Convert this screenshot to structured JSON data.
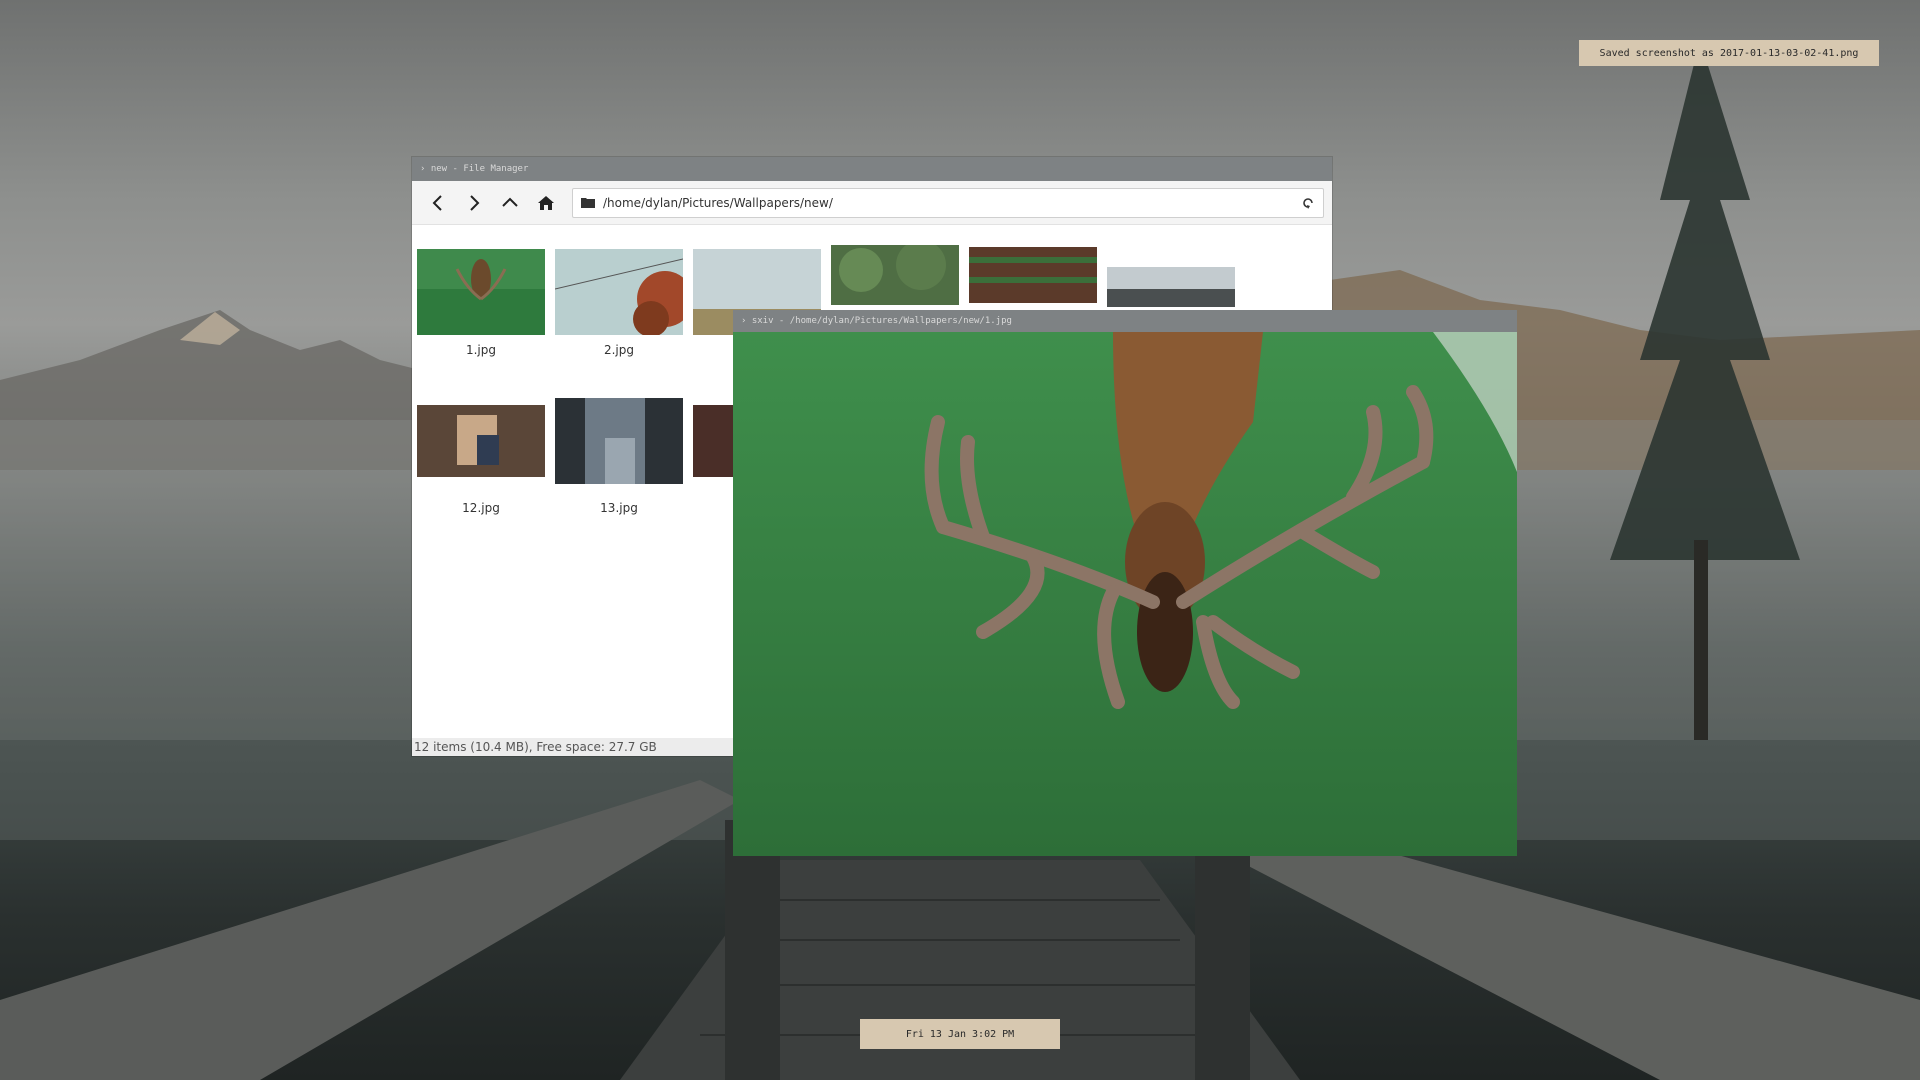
{
  "notification": {
    "text": "Saved screenshot as 2017-01-13-03-02-41.png"
  },
  "clock": {
    "text": "Fri 13 Jan  3:02 PM"
  },
  "file_manager": {
    "title": "› new - File Manager",
    "path": "/home/dylan/Pictures/Wallpapers/new/",
    "status": "12 items (10.4 MB), Free space: 27.7 GB",
    "items": [
      {
        "name": "1.jpg"
      },
      {
        "name": "2.jpg"
      },
      {
        "name": "12.jpg"
      },
      {
        "name": "13.jpg"
      }
    ]
  },
  "image_viewer": {
    "title": "› sxiv - /home/dylan/Pictures/Wallpapers/new/1.jpg"
  },
  "icons": [
    "back-icon",
    "forward-icon",
    "up-icon",
    "home-icon",
    "folder-icon",
    "reload-icon"
  ],
  "colors": {
    "titlebar": "#7e8284",
    "panel": "#d7c8b0"
  }
}
